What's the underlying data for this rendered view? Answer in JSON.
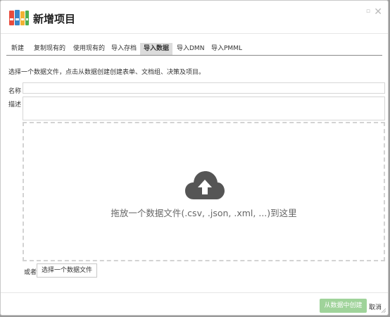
{
  "dialog": {
    "title": "新增项目",
    "window_controls": {
      "minimize_icon": "minimize-icon",
      "close_icon": "close-icon"
    },
    "app_icon": "binders-icon"
  },
  "tabs": [
    {
      "label": "新建",
      "active": false
    },
    {
      "label": "复制现有的",
      "active": false
    },
    {
      "label": "使用现有的",
      "active": false
    },
    {
      "label": "导入存档",
      "active": false
    },
    {
      "label": "导入数据",
      "active": true
    },
    {
      "label": "导入DMN",
      "active": false
    },
    {
      "label": "导入PMML",
      "active": false
    }
  ],
  "instruction": "选择一个数据文件，点击从数据创建创建表单、文档组、决策及项目。",
  "form": {
    "name_label": "名称",
    "name_value": "",
    "description_label": "描述",
    "description_value": ""
  },
  "dropzone": {
    "icon": "cloud-upload-icon",
    "text": "拖放一个数据文件(.csv, .json, .xml, ...)到这里"
  },
  "file_select": {
    "or_label": "或者",
    "button_label": "选择一个数据文件"
  },
  "footer": {
    "create_label": "从数据中创建",
    "cancel_label": "取消"
  },
  "colors": {
    "create_button": "#9fd39a",
    "cloud_icon": "#555555",
    "active_tab": "#dcdcdc"
  }
}
